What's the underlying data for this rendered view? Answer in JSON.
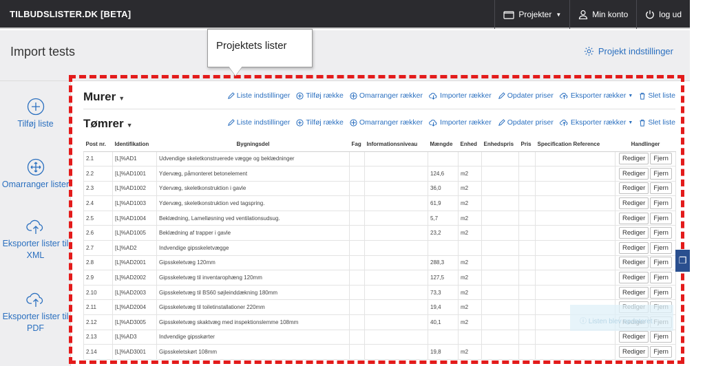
{
  "brand": "TILBUDSLISTER.DK [BETA]",
  "nav": {
    "projects": "Projekter",
    "account": "Min konto",
    "logout": "log ud"
  },
  "page": {
    "title": "Import tests",
    "settings_link": "Projekt indstillinger"
  },
  "callout": "Projektets lister",
  "sidebar": {
    "items": [
      {
        "icon": "plus-circle-icon",
        "label": "Tilføj liste"
      },
      {
        "icon": "move-icon",
        "label": "Omarranger lister"
      },
      {
        "icon": "cloud-upload-icon",
        "label": "Eksporter lister til XML"
      },
      {
        "icon": "cloud-upload-icon",
        "label": "Eksporter lister til PDF"
      }
    ]
  },
  "actions": {
    "settings": "Liste indstillinger",
    "add_row": "Tilføj række",
    "reorder": "Omarranger rækker",
    "import": "Importer rækker",
    "update_prices": "Opdater priser",
    "export": "Eksporter rækker",
    "delete": "Slet liste"
  },
  "lists": [
    {
      "title": "Murer"
    },
    {
      "title": "Tømrer"
    }
  ],
  "table": {
    "headers": [
      "Post nr.",
      "Identifikation",
      "Bygningsdel",
      "Fag",
      "Informationsniveau",
      "Mængde",
      "Enhed",
      "Enhedspris",
      "Pris",
      "Specification Reference",
      "Handlinger"
    ],
    "edit_label": "Rediger",
    "remove_label": "Fjern",
    "rows": [
      {
        "post": "2.1",
        "id": "[L]%AD1",
        "desc": "Udvendige skeletkonstruerede vægge og beklædninger",
        "qty": "",
        "unit": ""
      },
      {
        "post": "2.2",
        "id": "[L]%AD1001",
        "desc": "Ydervæg, påmonteret betonelement",
        "qty": "124,6",
        "unit": "m2"
      },
      {
        "post": "2.3",
        "id": "[L]%AD1002",
        "desc": "Ydervæg, skeletkonstruktion i gavle",
        "qty": "36,0",
        "unit": "m2"
      },
      {
        "post": "2.4",
        "id": "[L]%AD1003",
        "desc": "Ydervæg, skeletkonstruktion ved tagspring.",
        "qty": "61,9",
        "unit": "m2"
      },
      {
        "post": "2.5",
        "id": "[L]%AD1004",
        "desc": "Beklædning, Lamelløsning ved ventilationsudsug.",
        "qty": "5,7",
        "unit": "m2"
      },
      {
        "post": "2.6",
        "id": "[L]%AD1005",
        "desc": "Beklædning af trapper i gavle",
        "qty": "23,2",
        "unit": "m2"
      },
      {
        "post": "2.7",
        "id": "[L]%AD2",
        "desc": "Indvendige gipsskeletvægge",
        "qty": "",
        "unit": ""
      },
      {
        "post": "2.8",
        "id": "[L]%AD2001",
        "desc": "Gipsskeletvæg 120mm",
        "qty": "288,3",
        "unit": "m2"
      },
      {
        "post": "2.9",
        "id": "[L]%AD2002",
        "desc": "Gipsskeletvæg til inventarophæng 120mm",
        "qty": "127,5",
        "unit": "m2"
      },
      {
        "post": "2.10",
        "id": "[L]%AD2003",
        "desc": "Gipsskeletvæg til BS60 søjleinddækning 180mm",
        "qty": "73,3",
        "unit": "m2"
      },
      {
        "post": "2.11",
        "id": "[L]%AD2004",
        "desc": "Gipsskeletvæg til toiletinstallationer 220mm",
        "qty": "19,4",
        "unit": "m2"
      },
      {
        "post": "2.12",
        "id": "[L]%AD3005",
        "desc": "Gipsskeletvæg skaktvæg med inspektionslemme 108mm",
        "qty": "40,1",
        "unit": "m2"
      },
      {
        "post": "2.13",
        "id": "[L]%AD3",
        "desc": "Indvendige gipsskørter",
        "qty": "",
        "unit": ""
      },
      {
        "post": "2.14",
        "id": "[L]%AD3001",
        "desc": "Gipsskeletskørt 108mm",
        "qty": "19,8",
        "unit": "m2"
      }
    ]
  },
  "toast": "Listen blev opdateret",
  "colors": {
    "accent": "#2a6fbf",
    "annotation": "#e31b1b",
    "navbar": "#2b2b2f"
  }
}
